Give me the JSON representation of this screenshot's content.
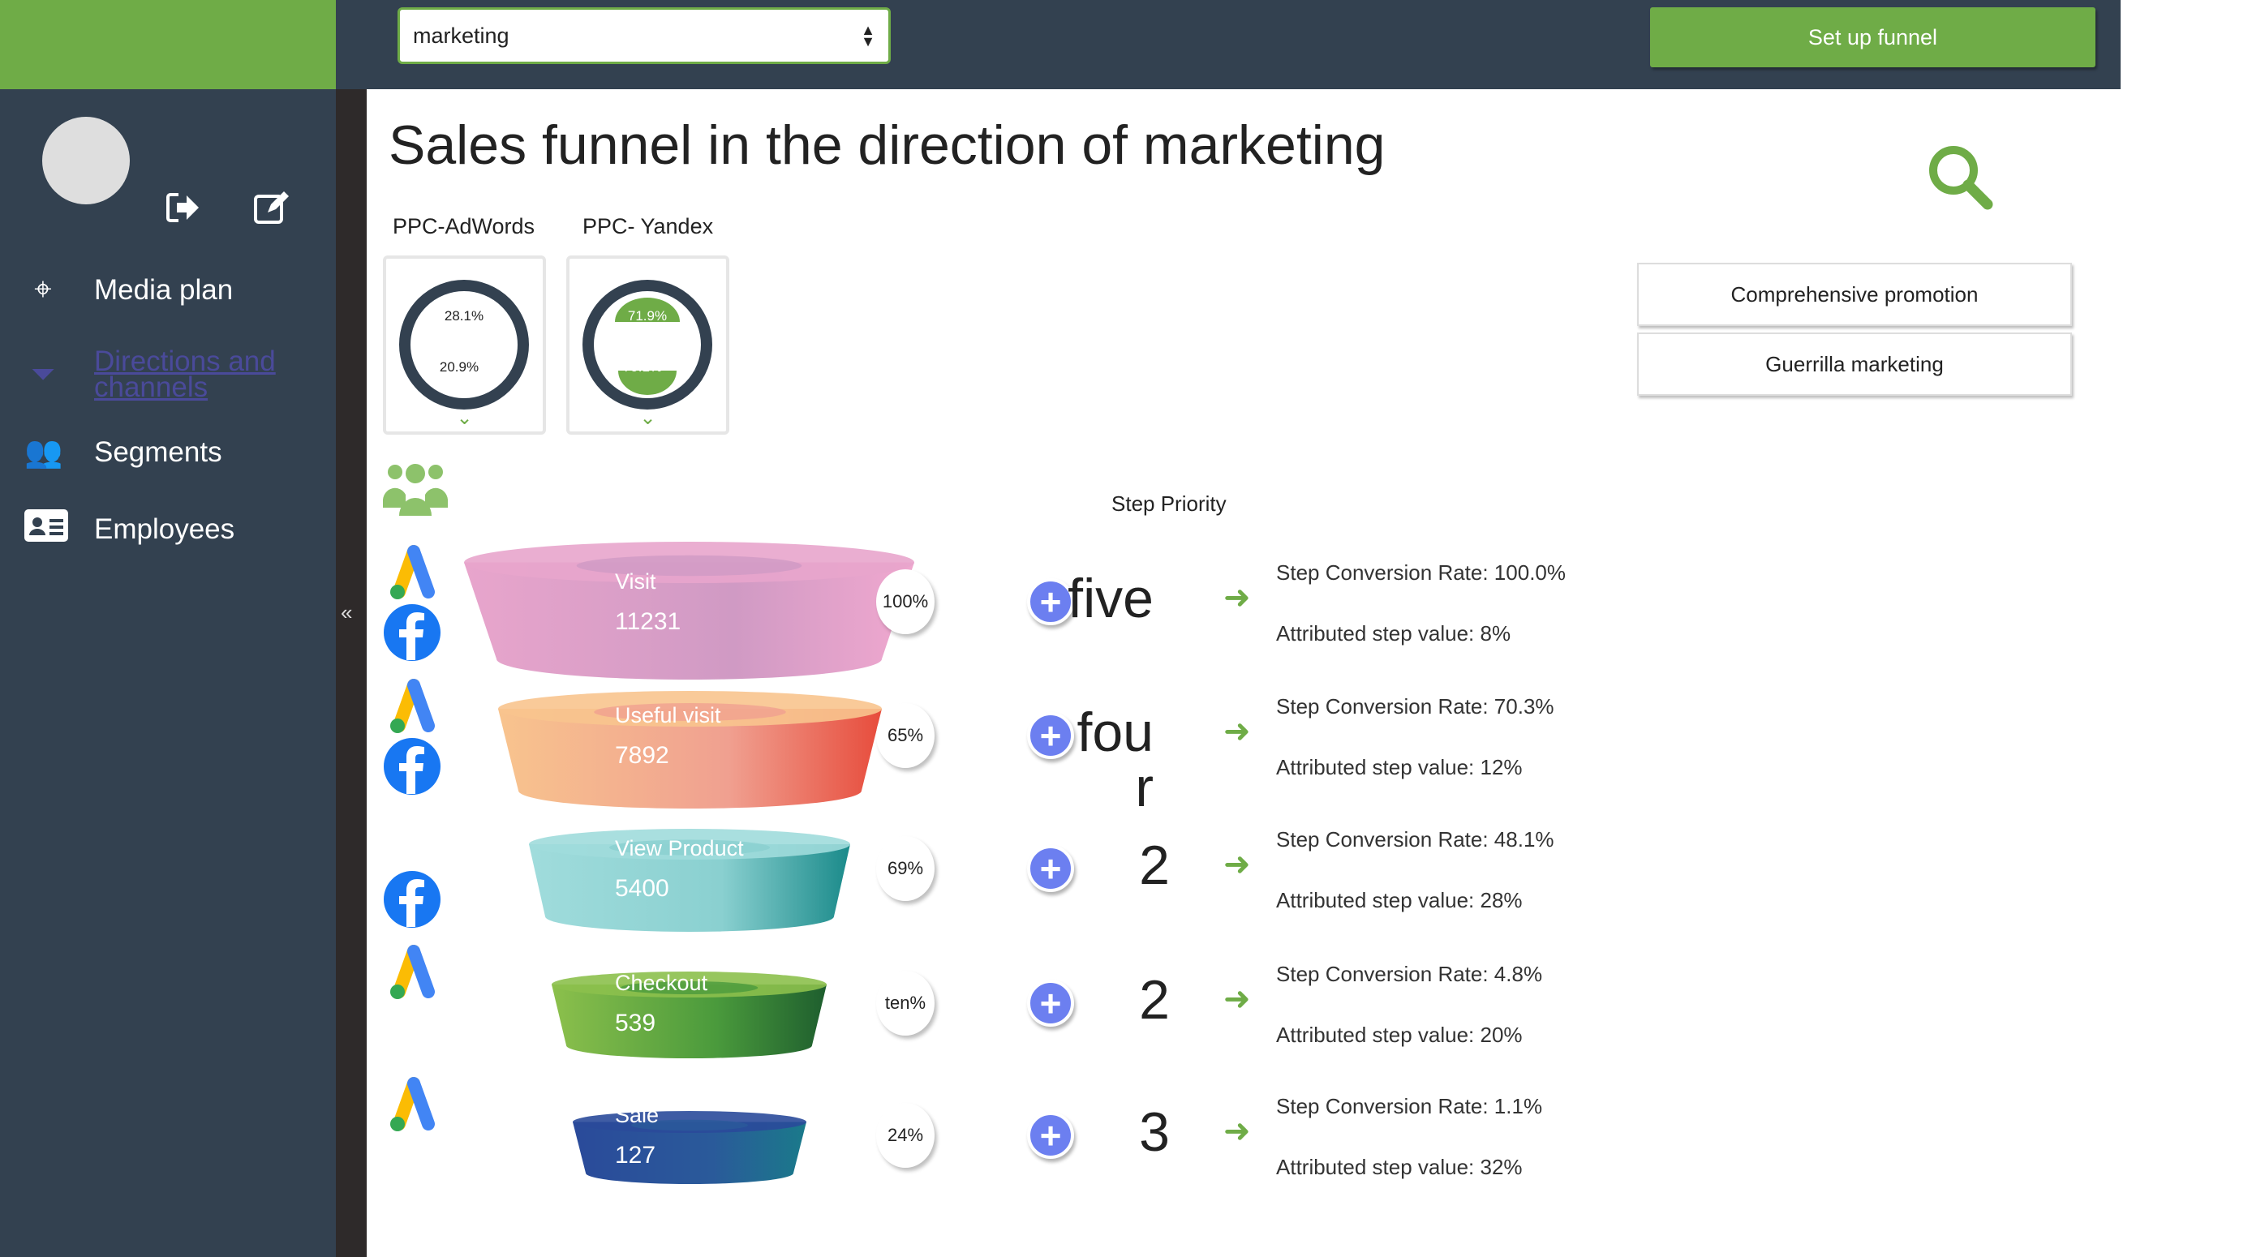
{
  "header": {
    "select_value": "marketing",
    "setup_button": "Set up funnel"
  },
  "sidebar": {
    "items": [
      {
        "label": "Media plan",
        "icon": "crosshair-icon"
      },
      {
        "label": "Directions and channels",
        "icon": "funnel-icon",
        "active": true
      },
      {
        "label": "Segments",
        "icon": "users-icon"
      },
      {
        "label": "Employees",
        "icon": "id-card-icon"
      }
    ],
    "collapse": "«"
  },
  "main": {
    "title": "Sales funnel in the direction of marketing",
    "channels": [
      {
        "name": "PPC-AdWords",
        "top": "28.1%",
        "bottom": "20.9%",
        "highlighted": false
      },
      {
        "name": "PPC- Yandex",
        "top": "71.9%",
        "bottom": "79.1%",
        "highlighted": true
      }
    ],
    "buttons": [
      "Comprehensive promotion",
      "Guerrilla marketing"
    ],
    "step_priority_label": "Step Priority",
    "steps": [
      {
        "label": "Visit",
        "count": "11231",
        "percent": "100%",
        "priority": "five",
        "rate": "Step Conversion Rate: 100.0%",
        "value": "Attributed step value: 8%",
        "sources": [
          "google-ads",
          "facebook"
        ]
      },
      {
        "label": "Useful visit",
        "count": "7892",
        "percent": "65%",
        "priority": "four",
        "rate": "Step Conversion Rate: 70.3%",
        "value": "Attributed step value: 12%",
        "sources": [
          "google-ads",
          "facebook"
        ]
      },
      {
        "label": "View Product",
        "count": "5400",
        "percent": "69%",
        "priority": "2",
        "rate": "Step Conversion Rate: 48.1%",
        "value": "Attributed step value: 28%",
        "sources": [
          "facebook"
        ]
      },
      {
        "label": "Checkout",
        "count": "539",
        "percent": "ten%",
        "priority": "2",
        "rate": "Step Conversion Rate: 4.8%",
        "value": "Attributed step value: 20%",
        "sources": [
          "google-ads"
        ]
      },
      {
        "label": "Sale",
        "count": "127",
        "percent": "24%",
        "priority": "3",
        "rate": "Step Conversion Rate: 1.1%",
        "value": "Attributed step value: 32%",
        "sources": [
          "google-ads"
        ]
      }
    ]
  },
  "colors": {
    "brand_green": "#6fac47",
    "sidebar": "#334150",
    "plus": "#6c7ff0"
  }
}
